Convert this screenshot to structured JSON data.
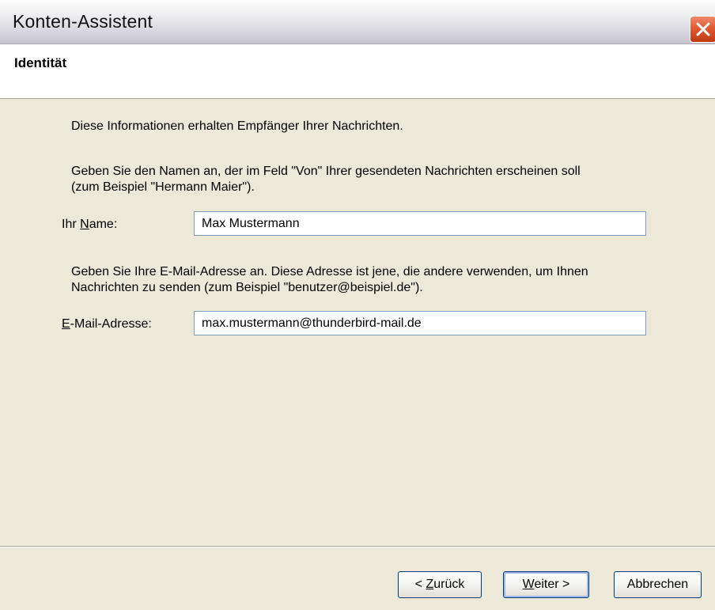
{
  "window": {
    "title": "Konten-Assistent"
  },
  "header": {
    "title": "Identität"
  },
  "content": {
    "intro": "Diese Informationen erhalten Empfänger Ihrer Nachrichten.",
    "name_help": "Geben Sie den Namen an, der im Feld \"Von\" Ihrer gesendeten Nachrichten erscheinen soll\n(zum Beispiel \"Hermann Maier\").",
    "name_label_mnemonic_pre": "Ihr ",
    "name_label_mnemonic_char": "N",
    "name_label_mnemonic_post": "ame:",
    "name_value": "Max Mustermann",
    "email_help": "Geben Sie Ihre E-Mail-Adresse an. Diese Adresse ist jene, die andere verwenden, um Ihnen\nNachrichten zu senden (zum Beispiel \"benutzer@beispiel.de\").",
    "email_label_mnemonic_char": "E",
    "email_label_mnemonic_post": "-Mail-Adresse:",
    "email_value": "max.mustermann@thunderbird-mail.de"
  },
  "buttons": {
    "back_pre": "< ",
    "back_char": "Z",
    "back_post": "urück",
    "next_char": "W",
    "next_post": "eiter >",
    "cancel": "Abbrechen"
  },
  "colors": {
    "dialog_bg": "#ece9d8",
    "close_button": "#e15a33",
    "button_border": "#003c74"
  },
  "icons": {
    "close": "close-icon"
  }
}
